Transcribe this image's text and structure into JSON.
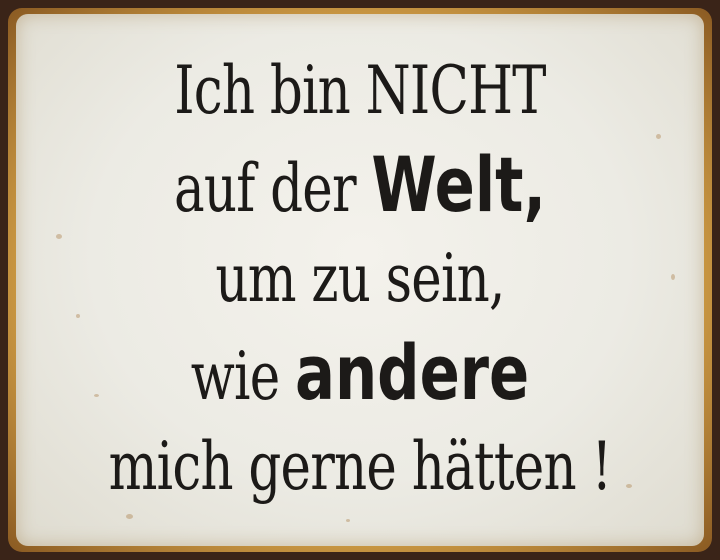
{
  "sign": {
    "lines": [
      {
        "parts": [
          {
            "text": "Ich bin NICHT",
            "style": "normal"
          }
        ]
      },
      {
        "parts": [
          {
            "text": "auf der ",
            "style": "normal"
          },
          {
            "text": "Welt,",
            "style": "bold"
          }
        ]
      },
      {
        "parts": [
          {
            "text": "um zu sein,",
            "style": "normal"
          }
        ]
      },
      {
        "parts": [
          {
            "text": "wie ",
            "style": "normal"
          },
          {
            "text": "andere",
            "style": "bold"
          }
        ]
      },
      {
        "parts": [
          {
            "text": "mich gerne hätten !",
            "style": "normal"
          }
        ]
      }
    ],
    "colors": {
      "background": "#ecebe4",
      "text": "#1c1a18",
      "frame": "#3a2418",
      "rust": "#d9a64a"
    }
  }
}
